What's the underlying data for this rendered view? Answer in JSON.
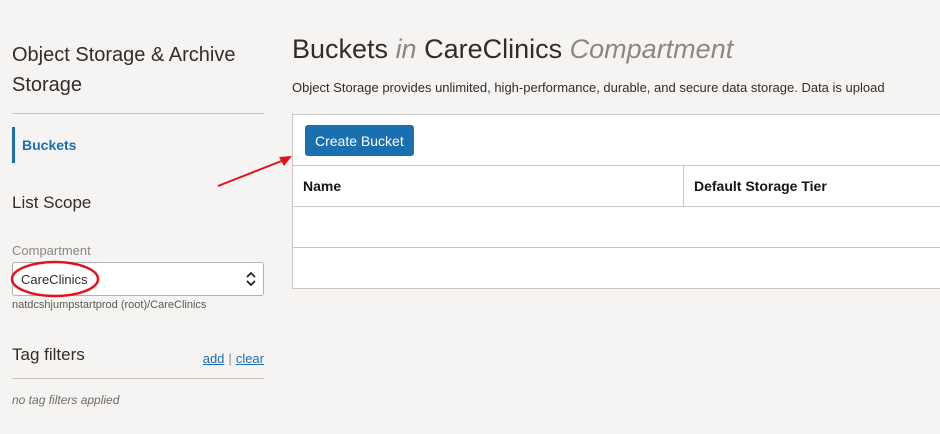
{
  "sidebar": {
    "title": "Object Storage & Archive Storage",
    "nav_items": [
      {
        "label": "Buckets",
        "active": true
      }
    ],
    "list_scope_title": "List Scope",
    "compartment_label": "Compartment",
    "compartment_value": "CareClinics",
    "compartment_path": "natdcshjumpstartprod (root)/CareClinics",
    "tag_filters_title": "Tag filters",
    "tag_add": "add",
    "tag_sep": "|",
    "tag_clear": "clear",
    "no_tags": "no tag filters applied"
  },
  "main": {
    "title_main": "Buckets",
    "title_in": "in",
    "title_compartment": "CareClinics",
    "title_suffix": "Compartment",
    "description": "Object Storage provides unlimited, high-performance, durable, and secure data storage. Data is upload",
    "create_button": "Create Bucket",
    "columns": [
      "Name",
      "Default Storage Tier"
    ]
  },
  "colors": {
    "accent": "#1a6fb0",
    "annotation": "#e0121b"
  }
}
